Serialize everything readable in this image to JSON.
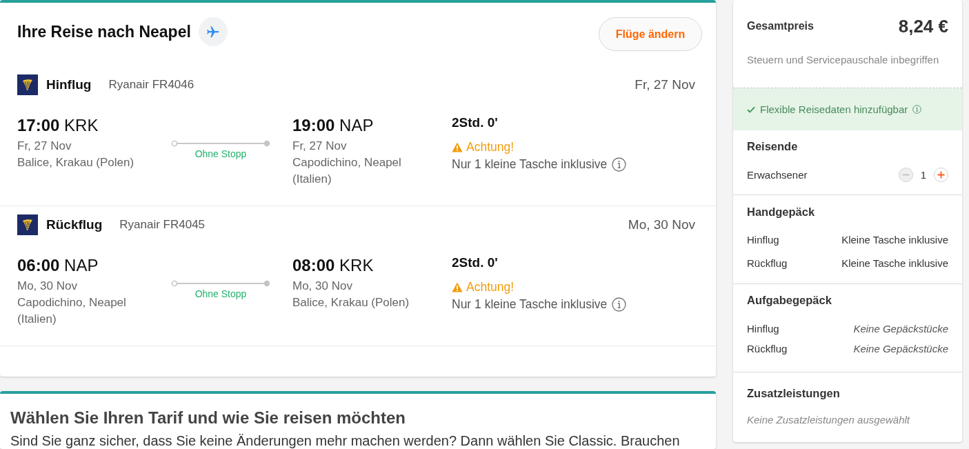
{
  "trip": {
    "title": "Ihre Reise nach Neapel",
    "change_button": "Flüge ändern",
    "flights": [
      {
        "direction": "Hinflug",
        "airline": "Ryanair FR4046",
        "date": "Fr, 27 Nov",
        "departure": {
          "time": "17:00",
          "airport": "KRK",
          "date": "Fr, 27 Nov",
          "place": "Balice, Krakau (Polen)"
        },
        "stops": "Ohne Stopp",
        "arrival": {
          "time": "19:00",
          "airport": "NAP",
          "date": "Fr, 27 Nov",
          "place": "Capodichino, Neapel (Italien)"
        },
        "duration": "2Std. 0'",
        "warning": "Achtung!",
        "baggage_note": "Nur 1 kleine Tasche inklusive"
      },
      {
        "direction": "Rückflug",
        "airline": "Ryanair FR4045",
        "date": "Mo, 30 Nov",
        "departure": {
          "time": "06:00",
          "airport": "NAP",
          "date": "Mo, 30 Nov",
          "place": "Capodichino, Neapel (Italien)"
        },
        "stops": "Ohne Stopp",
        "arrival": {
          "time": "08:00",
          "airport": "KRK",
          "date": "Mo, 30 Nov",
          "place": "Balice, Krakau (Polen)"
        },
        "duration": "2Std. 0'",
        "warning": "Achtung!",
        "baggage_note": "Nur 1 kleine Tasche inklusive"
      }
    ]
  },
  "fare": {
    "title": "Wählen Sie Ihren Tarif und wie Sie reisen möchten",
    "text": "Sind Sie ganz sicher, dass Sie keine Änderungen mehr machen werden? Dann wählen Sie Classic. Brauchen"
  },
  "summary": {
    "total_label": "Gesamtpreis",
    "total": "8,24 €",
    "note": "Steuern und Servicepauschale inbegriffen",
    "flex_notice": "Flexible Reisedaten hinzufügbar",
    "travellers": {
      "title": "Reisende",
      "label": "Erwachsener",
      "count": "1",
      "decrease_disabled": true,
      "increase_disabled": false
    },
    "cabin_baggage": {
      "title": "Handgepäck",
      "rows": [
        {
          "label": "Hinflug",
          "value": "Kleine Tasche inklusive"
        },
        {
          "label": "Rückflug",
          "value": "Kleine Tasche inklusive"
        }
      ]
    },
    "checked_baggage": {
      "title": "Aufgabegepäck",
      "rows": [
        {
          "label": "Hinflug",
          "value": "Keine Gepäckstücke"
        },
        {
          "label": "Rückflug",
          "value": "Keine Gepäckstücke"
        }
      ]
    },
    "extras": {
      "title": "Zusatzleistungen",
      "note": "Keine Zusatzleistungen ausgewählt"
    }
  }
}
